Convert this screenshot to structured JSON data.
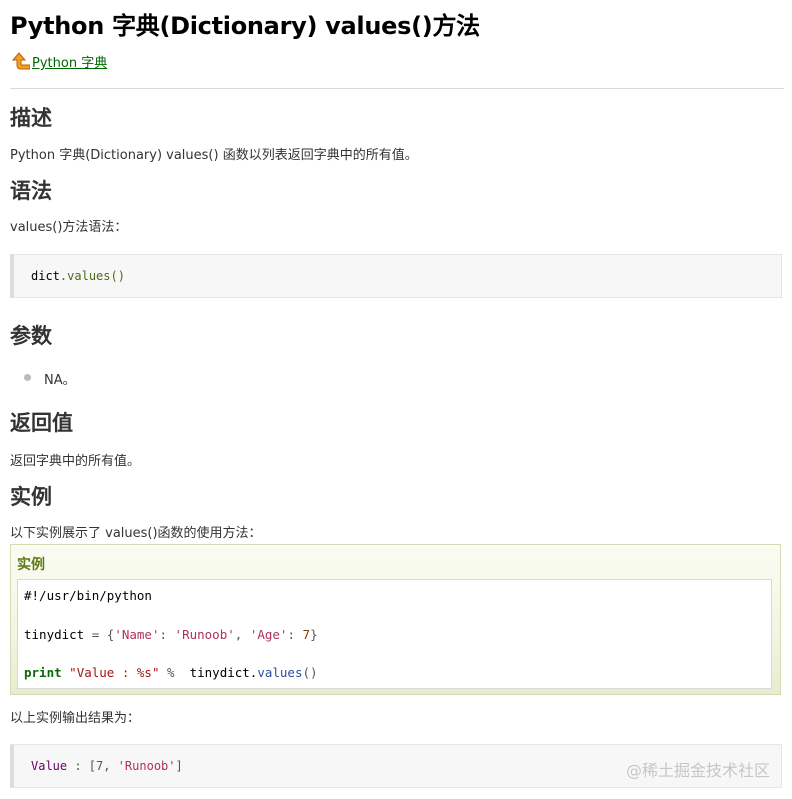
{
  "page": {
    "title": "Python 字典(Dictionary) values()方法",
    "back_link": "Python 字典"
  },
  "sections": {
    "description": {
      "heading": "描述",
      "text": "Python 字典(Dictionary) values() 函数以列表返回字典中的所有值。"
    },
    "syntax": {
      "heading": "语法",
      "intro": "values()方法语法：",
      "code_obj": "dict",
      "code_dot": ".",
      "code_call": "values()"
    },
    "params": {
      "heading": "参数",
      "item": "NA。"
    },
    "returns": {
      "heading": "返回值",
      "text": "返回字典中的所有值。"
    },
    "example": {
      "heading": "实例",
      "intro": "以下实例展示了 values()函数的使用方法：",
      "box_title": "实例",
      "shebang": "#!/usr/bin/python",
      "l2_var": "tinydict",
      "l2_eq": " = {",
      "l2_k1": "'Name'",
      "l2_c1": ": ",
      "l2_v1": "'Runoob'",
      "l2_sep": ", ",
      "l2_k2": "'Age'",
      "l2_c2": ": ",
      "l2_v2": "7",
      "l2_end": "}",
      "l3_kw": "print",
      "l3_str": "\"Value : %s\"",
      "l3_op": " %  ",
      "l3_obj": "tinydict.",
      "l3_fn": "values",
      "l3_end": "()",
      "output_intro": "以上实例输出结果为：",
      "out_label": "Value",
      "out_rest": " : [7, ",
      "out_str": "'Runoob'",
      "out_end": "]"
    }
  },
  "watermark": "@稀土掘金技术社区",
  "icons": {
    "back": "up-arrow-icon"
  },
  "colors": {
    "link": "#006600",
    "example_title": "#5c7a15"
  }
}
